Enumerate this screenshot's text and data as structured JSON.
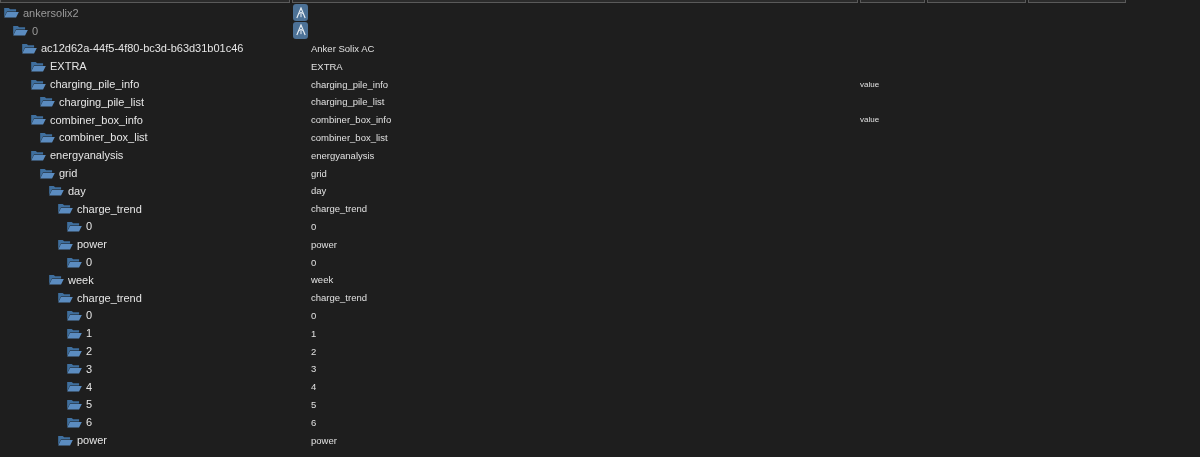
{
  "tree": [
    {
      "name": "ankersolix2",
      "dimmed": true,
      "button": true,
      "children": [
        {
          "name": "0",
          "dimmed": true,
          "button": true,
          "children": [
            {
              "name": "ac12d62a-44f5-4f80-bc3d-b63d31b01c46",
              "column_2": "Anker Solix AC",
              "dimmed": false,
              "button": false,
              "children": [
                {
                  "name": "EXTRA",
                  "column_2": "EXTRA",
                  "dimmed": false,
                  "button": false
                },
                {
                  "name": "charging_pile_info",
                  "column_2": "charging_pile_info",
                  "column_3": "value",
                  "dimmed": false,
                  "button": false,
                  "children": [
                    {
                      "name": "charging_pile_list",
                      "column_2": "charging_pile_list",
                      "dimmed": false,
                      "button": false
                    }
                  ]
                },
                {
                  "name": "combiner_box_info",
                  "column_2": "combiner_box_info",
                  "column_3": "value",
                  "dimmed": false,
                  "button": false,
                  "children": [
                    {
                      "name": "combiner_box_list",
                      "column_2": "combiner_box_list",
                      "dimmed": false,
                      "button": false
                    }
                  ]
                },
                {
                  "name": "energyanalysis",
                  "column_2": "energyanalysis",
                  "dimmed": false,
                  "button": false,
                  "children": [
                    {
                      "name": "grid",
                      "column_2": "grid",
                      "dimmed": false,
                      "button": false,
                      "children": [
                        {
                          "name": "day",
                          "column_2": "day",
                          "dimmed": false,
                          "button": false,
                          "children": [
                            {
                              "name": "charge_trend",
                              "column_2": "charge_trend",
                              "dimmed": false,
                              "button": false,
                              "children": [
                                {
                                  "name": "0",
                                  "column_2": "0",
                                  "dimmed": false,
                                  "button": false
                                }
                              ]
                            },
                            {
                              "name": "power",
                              "column_2": "power",
                              "dimmed": false,
                              "button": false,
                              "children": [
                                {
                                  "name": "0",
                                  "column_2": "0",
                                  "dimmed": false,
                                  "button": false
                                }
                              ]
                            }
                          ]
                        },
                        {
                          "name": "week",
                          "column_2": "week",
                          "dimmed": false,
                          "button": false,
                          "children": [
                            {
                              "name": "charge_trend",
                              "column_2": "charge_trend",
                              "dimmed": false,
                              "button": false,
                              "children": [
                                {
                                  "name": "0",
                                  "column_2": "0",
                                  "dimmed": false,
                                  "button": false
                                },
                                {
                                  "name": "1",
                                  "column_2": "1",
                                  "dimmed": false,
                                  "button": false
                                },
                                {
                                  "name": "2",
                                  "column_2": "2",
                                  "dimmed": false,
                                  "button": false
                                },
                                {
                                  "name": "3",
                                  "column_2": "3",
                                  "dimmed": false,
                                  "button": false
                                },
                                {
                                  "name": "4",
                                  "column_2": "4",
                                  "dimmed": false,
                                  "button": false
                                },
                                {
                                  "name": "5",
                                  "column_2": "5",
                                  "dimmed": false,
                                  "button": false
                                },
                                {
                                  "name": "6",
                                  "column_2": "6",
                                  "dimmed": false,
                                  "button": false
                                }
                              ]
                            },
                            {
                              "name": "power",
                              "column_2": "power",
                              "dimmed": false,
                              "button": false
                            }
                          ]
                        }
                      ]
                    }
                  ]
                }
              ]
            }
          ]
        }
      ]
    }
  ]
}
